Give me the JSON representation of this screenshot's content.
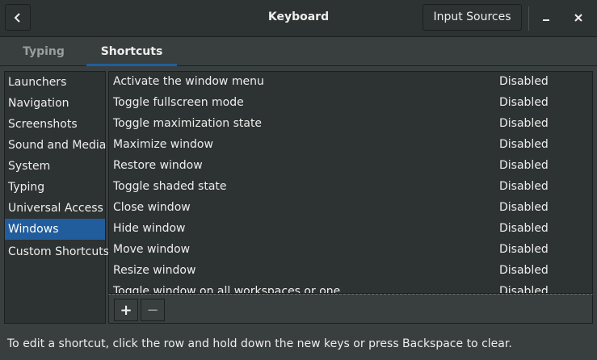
{
  "header": {
    "title": "Keyboard",
    "input_sources_label": "Input Sources",
    "back_icon": "chevron-left-icon",
    "minimize_icon": "minimize-icon",
    "close_icon": "close-icon"
  },
  "tabs": [
    {
      "label": "Typing",
      "active": false
    },
    {
      "label": "Shortcuts",
      "active": true
    }
  ],
  "sidebar": {
    "selected": "Windows",
    "items": [
      {
        "label": "Launchers"
      },
      {
        "label": "Navigation"
      },
      {
        "label": "Screenshots"
      },
      {
        "label": "Sound and Media"
      },
      {
        "label": "System"
      },
      {
        "label": "Typing"
      },
      {
        "label": "Universal Access"
      },
      {
        "label": "Windows"
      },
      {
        "label": "Custom Shortcuts"
      }
    ]
  },
  "shortcuts": [
    {
      "name": "Activate the window menu",
      "value": "Disabled"
    },
    {
      "name": "Toggle fullscreen mode",
      "value": "Disabled"
    },
    {
      "name": "Toggle maximization state",
      "value": "Disabled"
    },
    {
      "name": "Maximize window",
      "value": "Disabled"
    },
    {
      "name": "Restore window",
      "value": "Disabled"
    },
    {
      "name": "Toggle shaded state",
      "value": "Disabled"
    },
    {
      "name": "Close window",
      "value": "Disabled"
    },
    {
      "name": "Hide window",
      "value": "Disabled"
    },
    {
      "name": "Move window",
      "value": "Disabled"
    },
    {
      "name": "Resize window",
      "value": "Disabled"
    },
    {
      "name": "Toggle window on all workspaces or one",
      "value": "Disabled"
    }
  ],
  "toolbar": {
    "add_label": "+",
    "remove_label": "−"
  },
  "hint": "To edit a shortcut, click the row and hold down the new keys or press Backspace to clear.",
  "colors": {
    "accent": "#215d9c",
    "background": "#393f3f",
    "header": "#2d3232"
  }
}
